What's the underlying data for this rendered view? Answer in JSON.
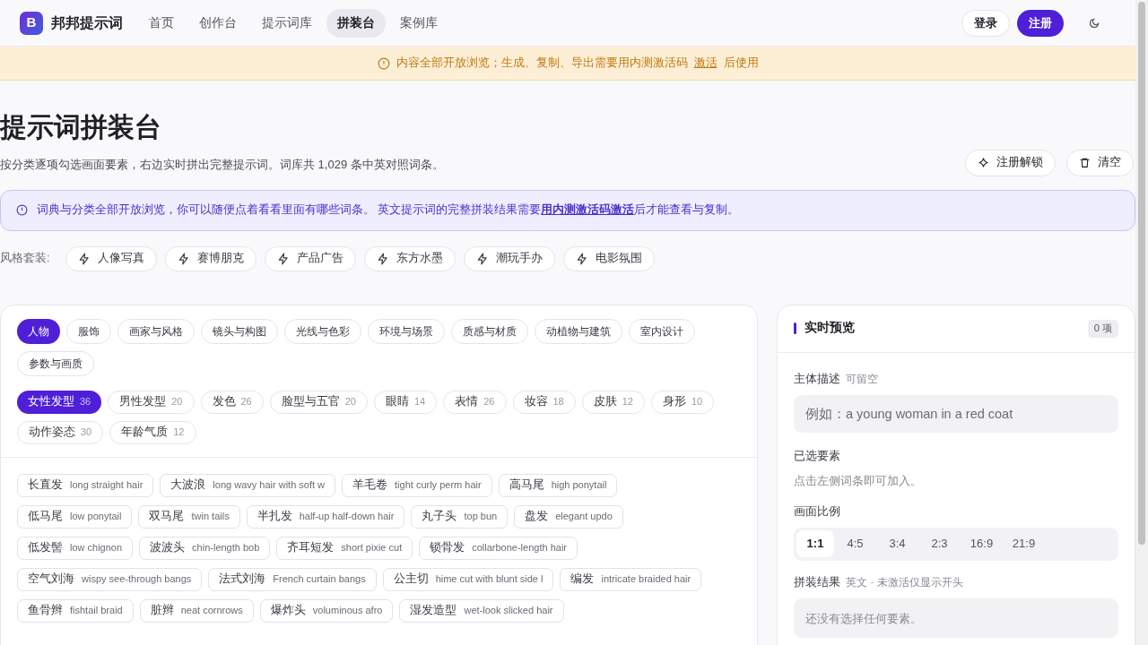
{
  "nav": {
    "logo_letter": "B",
    "brand": "邦邦提示词",
    "links": [
      {
        "label": "首页",
        "selected": false
      },
      {
        "label": "创作台",
        "selected": false
      },
      {
        "label": "提示词库",
        "selected": false
      },
      {
        "label": "拼装台",
        "selected": true
      },
      {
        "label": "案例库",
        "selected": false
      }
    ],
    "login": "登录",
    "register": "注册"
  },
  "notice": {
    "text": "内容全部开放浏览；生成、复制、导出需要用内测激活码",
    "link": "激活",
    "after": "后使用"
  },
  "header": {
    "title": "提示词拼装台",
    "subtitle": "按分类逐项勾选画面要素，右边实时拼出完整提示词。词库共 1,029 条中英对照词条。",
    "unlock": "注册解锁",
    "clear": "清空"
  },
  "info": {
    "text": "词典与分类全部开放浏览，你可以随便点着看看里面有哪些词条。 英文提示词的完整拼装结果需要",
    "link": "用内测激活码激活",
    "after": "后才能查看与复制。"
  },
  "presets": {
    "label": "风格套装:",
    "items": [
      "人像写真",
      "赛博朋克",
      "产品广告",
      "东方水墨",
      "潮玩手办",
      "电影氛围"
    ]
  },
  "categories": [
    {
      "label": "人物",
      "selected": true
    },
    {
      "label": "服饰",
      "selected": false
    },
    {
      "label": "画家与风格",
      "selected": false
    },
    {
      "label": "镜头与构图",
      "selected": false
    },
    {
      "label": "光线与色彩",
      "selected": false
    },
    {
      "label": "环境与场景",
      "selected": false
    },
    {
      "label": "质感与材质",
      "selected": false
    },
    {
      "label": "动植物与建筑",
      "selected": false
    },
    {
      "label": "室内设计",
      "selected": false
    },
    {
      "label": "参数与画质",
      "selected": false
    }
  ],
  "subcategories": [
    {
      "label": "女性发型",
      "count": "36",
      "selected": true
    },
    {
      "label": "男性发型",
      "count": "20",
      "selected": false
    },
    {
      "label": "发色",
      "count": "26",
      "selected": false
    },
    {
      "label": "脸型与五官",
      "count": "20",
      "selected": false
    },
    {
      "label": "眼睛",
      "count": "14",
      "selected": false
    },
    {
      "label": "表情",
      "count": "26",
      "selected": false
    },
    {
      "label": "妆容",
      "count": "18",
      "selected": false
    },
    {
      "label": "皮肤",
      "count": "12",
      "selected": false
    },
    {
      "label": "身形",
      "count": "10",
      "selected": false
    },
    {
      "label": "动作姿态",
      "count": "30",
      "selected": false
    },
    {
      "label": "年龄气质",
      "count": "12",
      "selected": false
    }
  ],
  "terms": [
    {
      "cn": "长直发",
      "en": "long straight hair"
    },
    {
      "cn": "大波浪",
      "en": "long wavy hair with soft w"
    },
    {
      "cn": "羊毛卷",
      "en": "tight curly perm hair"
    },
    {
      "cn": "高马尾",
      "en": "high ponytail"
    },
    {
      "cn": "低马尾",
      "en": "low ponytail"
    },
    {
      "cn": "双马尾",
      "en": "twin tails"
    },
    {
      "cn": "半扎发",
      "en": "half-up half-down hair"
    },
    {
      "cn": "丸子头",
      "en": "top bun"
    },
    {
      "cn": "盘发",
      "en": "elegant updo"
    },
    {
      "cn": "低发髻",
      "en": "low chignon"
    },
    {
      "cn": "波波头",
      "en": "chin-length bob"
    },
    {
      "cn": "齐耳短发",
      "en": "short pixie cut"
    },
    {
      "cn": "锁骨发",
      "en": "collarbone-length hair"
    },
    {
      "cn": "空气刘海",
      "en": "wispy see-through bangs"
    },
    {
      "cn": "法式刘海",
      "en": "French curtain bangs"
    },
    {
      "cn": "公主切",
      "en": "hime cut with blunt side l"
    },
    {
      "cn": "编发",
      "en": "intricate braided hair"
    },
    {
      "cn": "鱼骨辫",
      "en": "fishtail braid"
    },
    {
      "cn": "脏辫",
      "en": "neat cornrows"
    },
    {
      "cn": "爆炸头",
      "en": "voluminous afro"
    },
    {
      "cn": "湿发造型",
      "en": "wet-look slicked hair"
    }
  ],
  "preview": {
    "title": "实时预览",
    "count": "0 项",
    "subject_label": "主体描述",
    "subject_hint": "可留空",
    "subject_placeholder": "例如：a young woman in a red coat",
    "selected_label": "已选要素",
    "selected_empty": "点击左侧词条即可加入。",
    "ratio_label": "画面比例",
    "ratios": [
      {
        "label": "1:1",
        "selected": true
      },
      {
        "label": "4:5",
        "selected": false
      },
      {
        "label": "3:4",
        "selected": false
      },
      {
        "label": "2:3",
        "selected": false
      },
      {
        "label": "16:9",
        "selected": false
      },
      {
        "label": "21:9",
        "selected": false
      }
    ],
    "result_label": "拼装结果",
    "result_hint": "英文 · 未激活仅显示开头",
    "result_empty": "还没有选择任何要素。"
  }
}
